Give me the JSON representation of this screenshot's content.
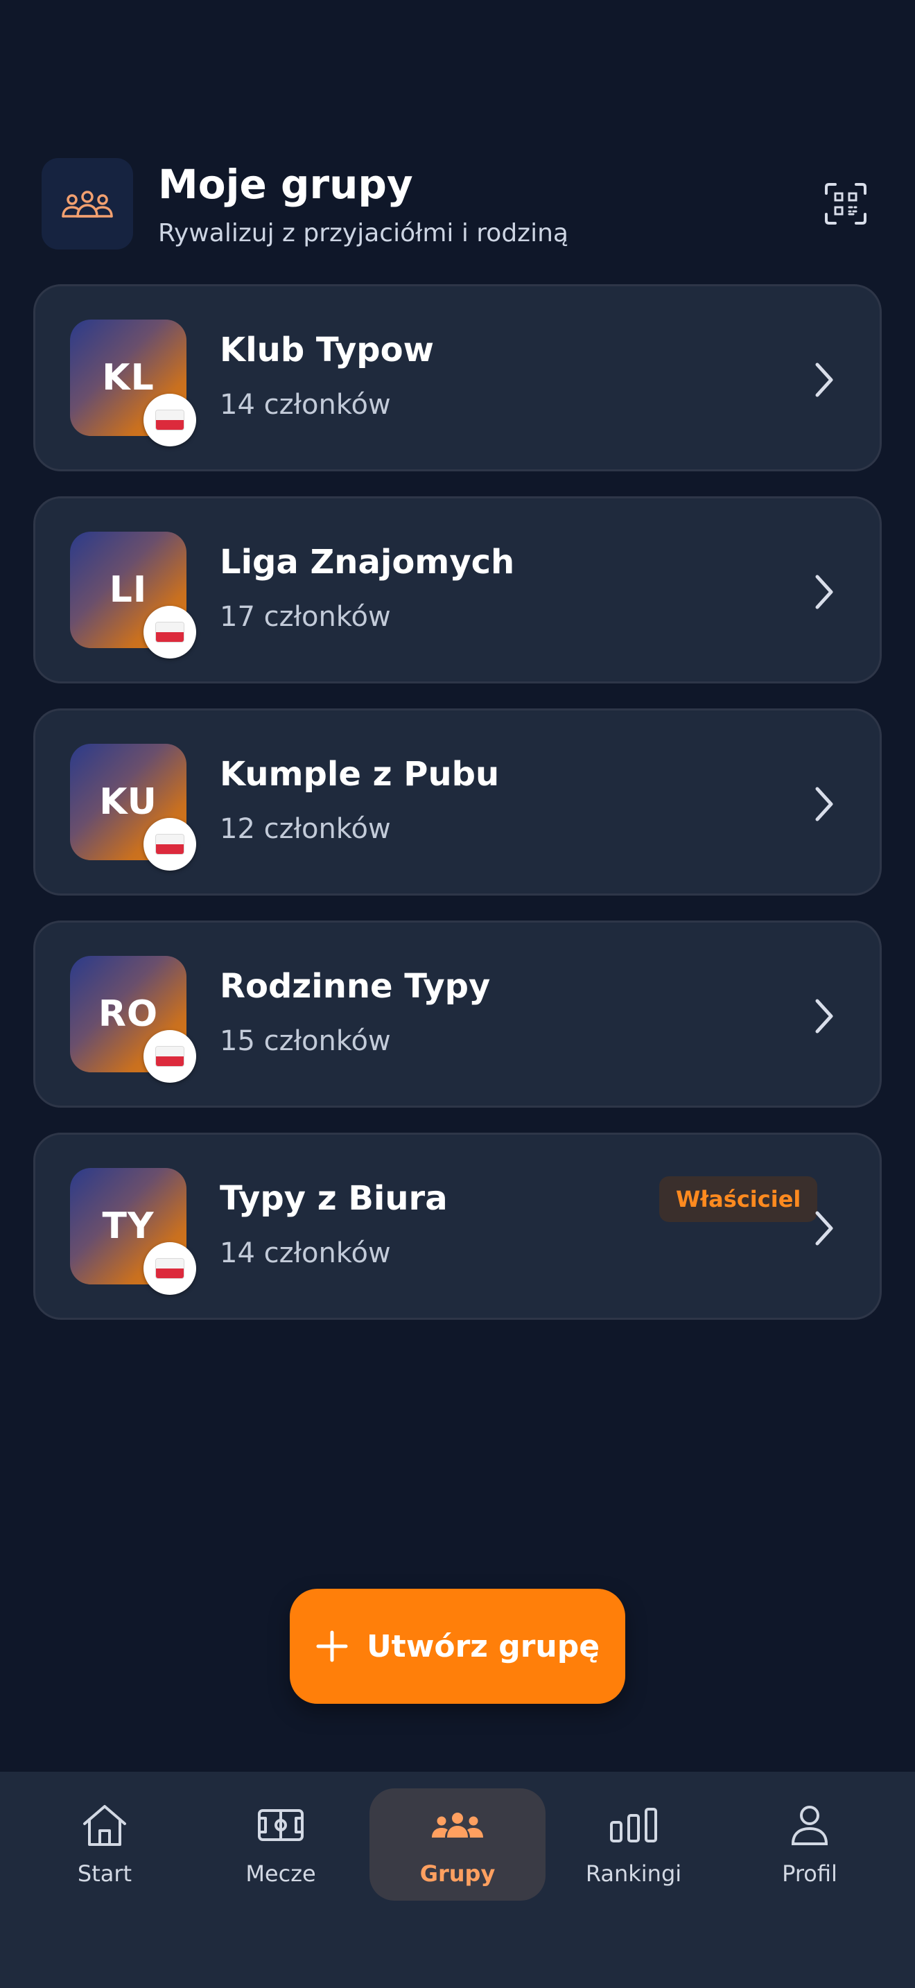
{
  "header": {
    "title": "Moje grupy",
    "subtitle": "Rywalizuj z przyjaciółmi i rodziną",
    "icon": "users-icon",
    "action_icon": "qr-code-icon"
  },
  "groups": [
    {
      "initials": "KL",
      "name": "Klub Typow",
      "members": "14 członków",
      "flag": "poland-flag",
      "owner": false
    },
    {
      "initials": "LI",
      "name": "Liga Znajomych",
      "members": "17 członków",
      "flag": "poland-flag",
      "owner": false
    },
    {
      "initials": "KU",
      "name": "Kumple z Pubu",
      "members": "12 członków",
      "flag": "poland-flag",
      "owner": false
    },
    {
      "initials": "RO",
      "name": "Rodzinne Typy",
      "members": "15 członków",
      "flag": "poland-flag",
      "owner": false
    },
    {
      "initials": "TY",
      "name": "Typy z Biura",
      "members": "14 członków",
      "flag": "poland-flag",
      "owner": true,
      "badge": "Właściciel"
    }
  ],
  "create_button": {
    "label": "Utwórz grupę",
    "icon": "plus-icon"
  },
  "nav": {
    "active": "Grupy",
    "items": [
      {
        "label": "Start",
        "icon": "home-icon"
      },
      {
        "label": "Mecze",
        "icon": "football-pitch-icon"
      },
      {
        "label": "Grupy",
        "icon": "users-icon"
      },
      {
        "label": "Rankingi",
        "icon": "bar-chart-icon"
      },
      {
        "label": "Profil",
        "icon": "user-icon"
      }
    ]
  },
  "colors": {
    "background": "#0f1729",
    "card": "#1f2a3d",
    "accent": "#ff7f0a",
    "owner_badge_text": "#ff8a1f",
    "active_nav_label": "#ffa060"
  }
}
